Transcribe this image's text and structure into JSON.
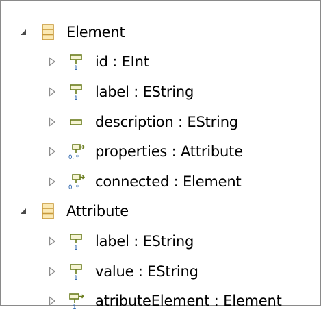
{
  "tree": {
    "classes": [
      {
        "label": "Element",
        "expanded": true,
        "icon": "eclass-icon",
        "features": [
          {
            "label": "id : EInt",
            "icon": "eattribute-single-icon"
          },
          {
            "label": "label : EString",
            "icon": "eattribute-single-icon"
          },
          {
            "label": "description : EString",
            "icon": "eattribute-optional-icon"
          },
          {
            "label": "properties : Attribute",
            "icon": "ereference-many-icon"
          },
          {
            "label": "connected : Element",
            "icon": "ereference-many-icon"
          }
        ]
      },
      {
        "label": "Attribute",
        "expanded": true,
        "icon": "eclass-icon",
        "features": [
          {
            "label": "label : EString",
            "icon": "eattribute-single-icon"
          },
          {
            "label": "value : EString",
            "icon": "eattribute-single-icon"
          },
          {
            "label": "atributeElement : Element",
            "icon": "ereference-single-icon"
          }
        ]
      }
    ]
  },
  "colors": {
    "class_fill": "#fbe9b4",
    "class_stroke": "#c89a3c",
    "feature_stroke": "#6b7d1e",
    "feature_fill": "#f6f4d4",
    "reference_blue": "#1e5aa8",
    "twisty_expanded": "#4a4a4a",
    "twisty_collapsed": "#8c8c8c"
  }
}
